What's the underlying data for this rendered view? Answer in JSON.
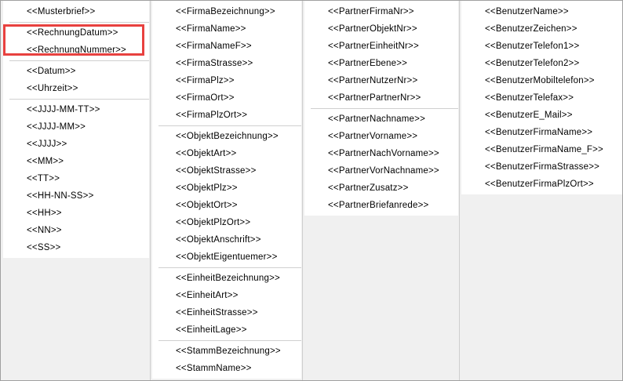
{
  "columns": [
    {
      "groups": [
        [
          "<<Musterbrief>>"
        ],
        [
          "<<RechnungDatum>>",
          "<<RechnungNummer>>"
        ],
        [
          "<<Datum>>",
          "<<Uhrzeit>>"
        ],
        [
          "<<JJJJ-MM-TT>>",
          "<<JJJJ-MM>>",
          "<<JJJJ>>",
          "<<MM>>",
          "<<TT>>",
          "<<HH-NN-SS>>",
          "<<HH>>",
          "<<NN>>",
          "<<SS>>"
        ]
      ]
    },
    {
      "groups": [
        [
          "<<FirmaBezeichnung>>",
          "<<FirmaName>>",
          "<<FirmaNameF>>",
          "<<FirmaStrasse>>",
          "<<FirmaPlz>>",
          "<<FirmaOrt>>",
          "<<FirmaPlzOrt>>"
        ],
        [
          "<<ObjektBezeichnung>>",
          "<<ObjektArt>>",
          "<<ObjektStrasse>>",
          "<<ObjektPlz>>",
          "<<ObjektOrt>>",
          "<<ObjektPlzOrt>>",
          "<<ObjektAnschrift>>",
          "<<ObjektEigentuemer>>"
        ],
        [
          "<<EinheitBezeichnung>>",
          "<<EinheitArt>>",
          "<<EinheitStrasse>>",
          "<<EinheitLage>>"
        ],
        [
          "<<StammBezeichnung>>",
          "<<StammName>>"
        ]
      ]
    },
    {
      "groups": [
        [
          "<<PartnerFirmaNr>>",
          "<<PartnerObjektNr>>",
          "<<PartnerEinheitNr>>",
          "<<PartnerEbene>>",
          "<<PartnerNutzerNr>>",
          "<<PartnerPartnerNr>>"
        ],
        [
          "<<PartnerNachname>>",
          "<<PartnerVorname>>",
          "<<PartnerNachVorname>>",
          "<<PartnerVorNachname>>",
          "<<PartnerZusatz>>",
          "<<PartnerBriefanrede>>"
        ]
      ]
    },
    {
      "groups": [
        [
          "<<BenutzerName>>",
          "<<BenutzerZeichen>>",
          "<<BenutzerTelefon1>>",
          "<<BenutzerTelefon2>>",
          "<<BenutzerMobiltelefon>>",
          "<<BenutzerTelefax>>",
          "<<BenutzerE_Mail>>",
          "<<BenutzerFirmaName>>",
          "<<BenutzerFirmaName_F>>",
          "<<BenutzerFirmaStrasse>>",
          "<<BenutzerFirmaPlzOrt>>"
        ]
      ]
    }
  ],
  "highlight_color": "#e8413f"
}
